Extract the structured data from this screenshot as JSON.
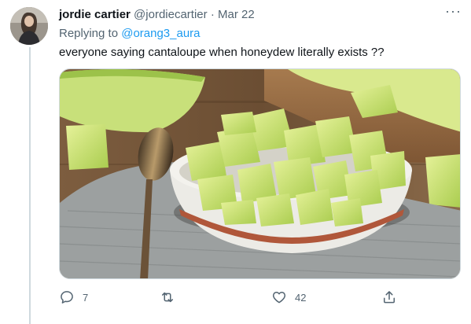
{
  "tweet": {
    "display_name": "jordie cartier",
    "handle": "@jordiecartier",
    "separator": "·",
    "date": "Mar 22",
    "replying_prefix": "Replying to",
    "replying_to": "@orang3_aura",
    "text": "everyone saying cantaloupe when honeydew literally exists ??",
    "media_icon": "honeydew-melon-bowl-photo",
    "avatar_icon": "user-avatar-photo"
  },
  "actions": {
    "reply_icon": "reply-icon",
    "reply_count": "7",
    "retweet_icon": "retweet-icon",
    "retweet_count": "",
    "like_icon": "heart-icon",
    "like_count": "42",
    "share_icon": "share-icon"
  },
  "colors": {
    "text": "#0f1419",
    "muted": "#536471",
    "link": "#1d9bf0",
    "border": "#cfd9de"
  }
}
